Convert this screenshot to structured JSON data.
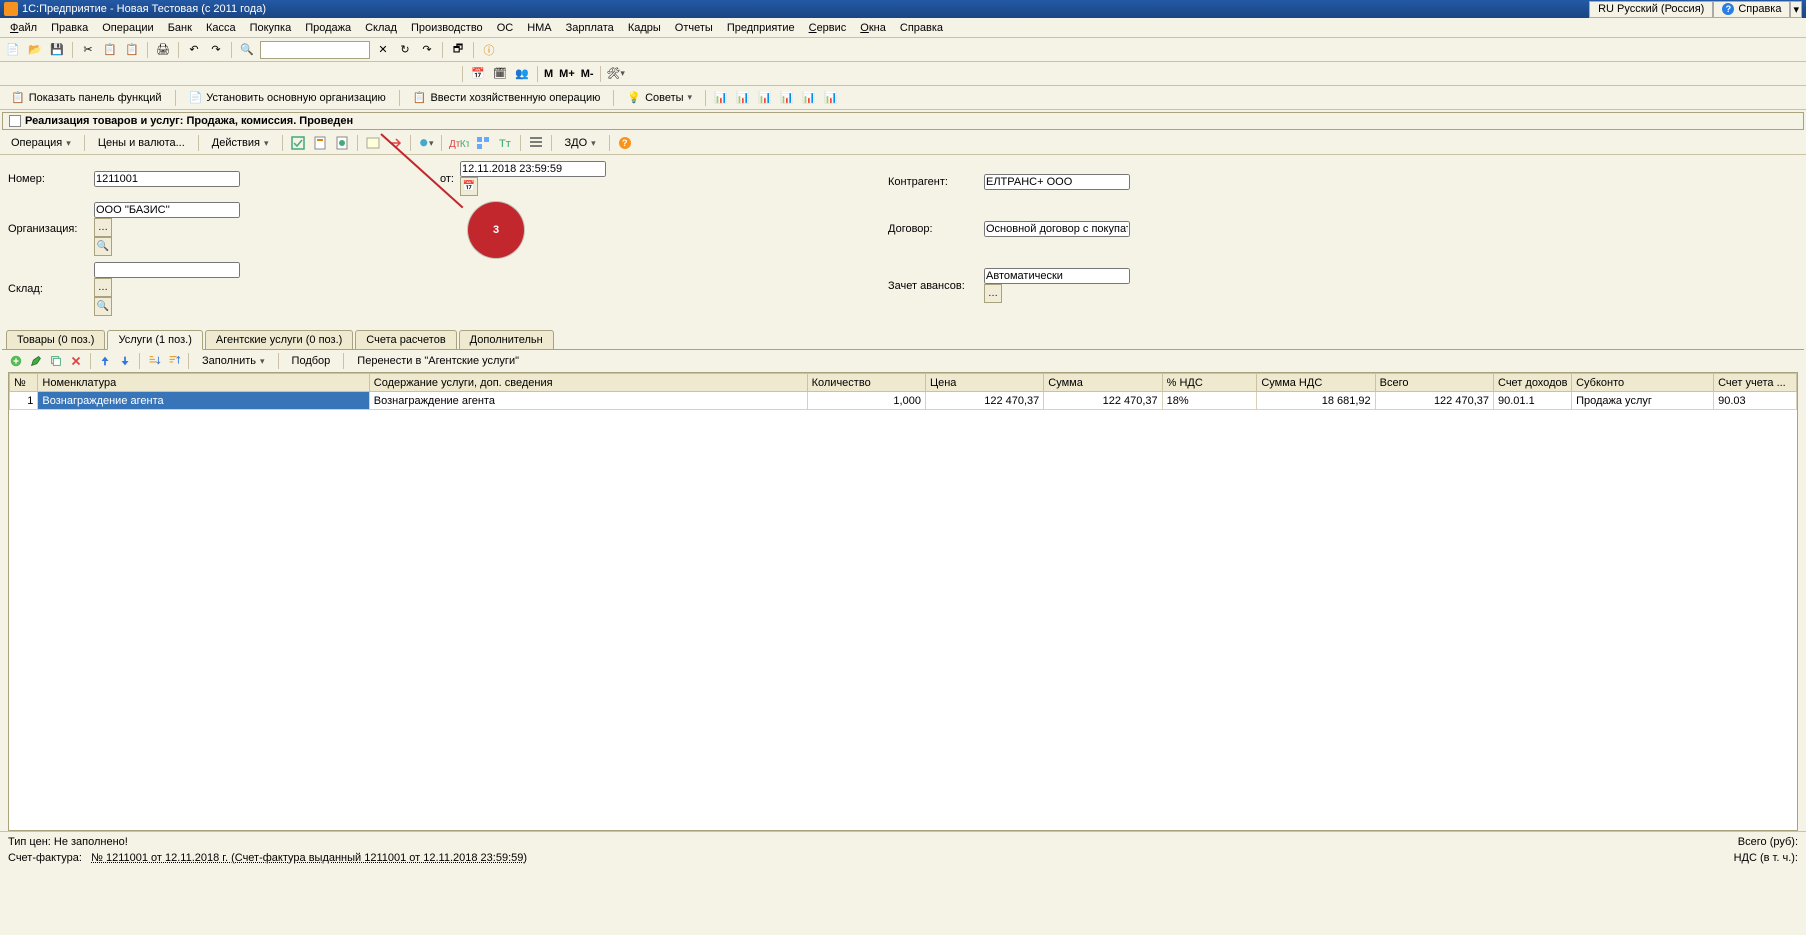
{
  "titlebar": {
    "title": "1С:Предприятие - Новая Тестовая (с 2011 года)",
    "lang_btn": "RU Русский (Россия)",
    "help_btn": "Справка"
  },
  "menu": [
    "Файл",
    "Правка",
    "Операции",
    "Банк",
    "Касса",
    "Покупка",
    "Продажа",
    "Склад",
    "Производство",
    "ОС",
    "НМА",
    "Зарплата",
    "Кадры",
    "Отчеты",
    "Предприятие",
    "Сервис",
    "Окна",
    "Справка"
  ],
  "toolbar3": {
    "show_panel": "Показать панель функций",
    "set_org": "Установить основную организацию",
    "enter_op": "Ввести хозяйственную операцию",
    "advice": "Советы"
  },
  "doc_header": "Реализация товаров и услуг: Продажа, комиссия. Проведен",
  "toolbar2": {
    "operation": "Операция",
    "prices": "Цены и валюта...",
    "actions": "Действия",
    "zdo": "ЗДО"
  },
  "form": {
    "number_lbl": "Номер:",
    "number": "1211001",
    "date_lbl": "от:",
    "date": "12.11.2018 23:59:59",
    "org_lbl": "Организация:",
    "org": "ООО ''БАЗИС''",
    "warehouse_lbl": "Склад:",
    "warehouse": "",
    "counterpart_lbl": "Контрагент:",
    "counterpart": "ЕЛТРАНС+ ООО",
    "contract_lbl": "Договор:",
    "contract": "Основной договор с покупателем",
    "advance_lbl": "Зачет авансов:",
    "advance": "Автоматически"
  },
  "tabs": {
    "goods": "Товары (0 поз.)",
    "services": "Услуги (1 поз.)",
    "agent": "Агентские услуги (0 поз.)",
    "accounts": "Счета расчетов",
    "additional": "Дополнительн"
  },
  "subtoolbar": {
    "fill": "Заполнить",
    "select": "Подбор",
    "transfer": "Перенести в \"Агентские услуги\""
  },
  "grid": {
    "cols": {
      "n": "№",
      "nomen": "Номенклатура",
      "content": "Содержание услуги, доп. сведения",
      "qty": "Количество",
      "price": "Цена",
      "sum": "Сумма",
      "vat_pct": "% НДС",
      "vat_sum": "Сумма НДС",
      "total": "Всего",
      "income_acc": "Счет доходов",
      "subconto": "Субконто",
      "acc": "Счет учета ..."
    },
    "rows": [
      {
        "n": "1",
        "nomen": "Вознаграждение агента",
        "content": "Вознаграждение агента",
        "qty": "1,000",
        "price": "122 470,37",
        "sum": "122 470,37",
        "vat_pct": "18%",
        "vat_sum": "18 681,92",
        "total": "122 470,37",
        "income_acc": "90.01.1",
        "subconto": "Продажа услуг",
        "acc": "90.03"
      }
    ]
  },
  "footer": {
    "price_type_lbl": "Тип цен: Не заполнено!",
    "invoice_lbl": "Счет-фактура:",
    "invoice_link": "№ 1211001 от 12.11.2018 г. (Счет-фактура выданный 1211001 от 12.11.2018 23:59:59)",
    "total_lbl": "Всего (руб):",
    "vat_lbl": "НДС (в т. ч.):"
  },
  "callout": {
    "num": "3"
  }
}
